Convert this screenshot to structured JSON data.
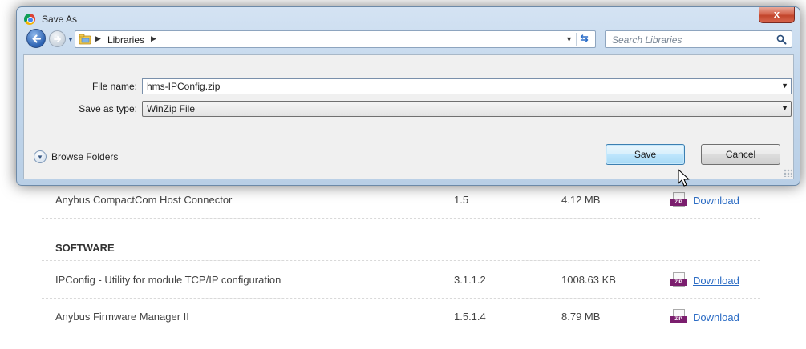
{
  "dialog": {
    "title": "Save As",
    "close_label": "x",
    "address": {
      "path": "Libraries"
    },
    "search": {
      "placeholder": "Search Libraries"
    },
    "file_name": {
      "label": "File name:",
      "value": "hms-IPConfig.zip"
    },
    "save_as_type": {
      "label": "Save as type:",
      "value": "WinZip File"
    },
    "browse_folders_label": "Browse Folders",
    "save_label": "Save",
    "cancel_label": "Cancel"
  },
  "page": {
    "rows_top": [
      {
        "name": "Anybus CompactCom Host Connector",
        "version": "1.5",
        "size": "4.12 MB",
        "download": "Download"
      }
    ],
    "section_title": "SOFTWARE",
    "rows_software": [
      {
        "name": "IPConfig - Utility for module TCP/IP configuration",
        "version": "3.1.1.2",
        "size": "1008.63 KB",
        "download": "Download"
      },
      {
        "name": "Anybus Firmware Manager II",
        "version": "1.5.1.4",
        "size": "8.79 MB",
        "download": "Download"
      }
    ],
    "zip_badge": "ZIP"
  },
  "icons": [
    "chrome-icon",
    "back-arrow-icon",
    "forward-arrow-icon",
    "libraries-folder-icon",
    "refresh-icon",
    "search-icon",
    "chevron-down-icon",
    "zip-file-icon",
    "mouse-cursor-icon"
  ],
  "colors": {
    "link": "#2a6bc4",
    "zip_badge": "#7b1e6e",
    "close_button": "#c2452c",
    "dialog_chrome": "#c3d7ec"
  }
}
